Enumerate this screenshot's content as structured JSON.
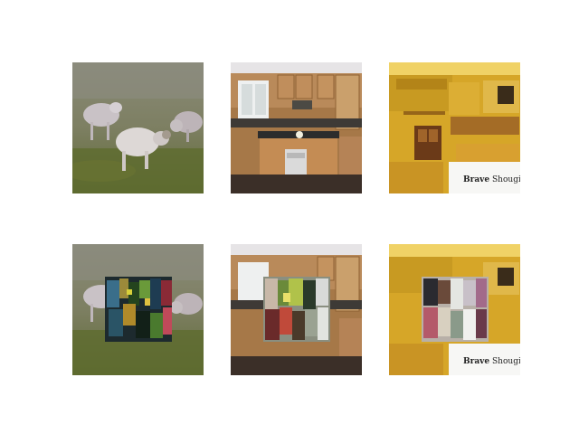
{
  "grid": {
    "rows": 2,
    "cols": 3,
    "tiles": [
      {
        "id": "ram-original",
        "subject": "bighorn rams fighting on grassland"
      },
      {
        "id": "kitchen-original",
        "subject": "wooden kitchen interior"
      },
      {
        "id": "yellow-room-original",
        "subject": "yellow kitchen with sign",
        "caption_a": "Brave",
        "caption_b": "Shougi"
      },
      {
        "id": "ram-patched",
        "subject": "bighorn rams with adversarial patch"
      },
      {
        "id": "kitchen-patched",
        "subject": "wooden kitchen with adversarial patch"
      },
      {
        "id": "yellow-room-patched",
        "subject": "yellow kitchen with adversarial patch",
        "caption_a": "Brave",
        "caption_b": "Shougi"
      }
    ]
  }
}
